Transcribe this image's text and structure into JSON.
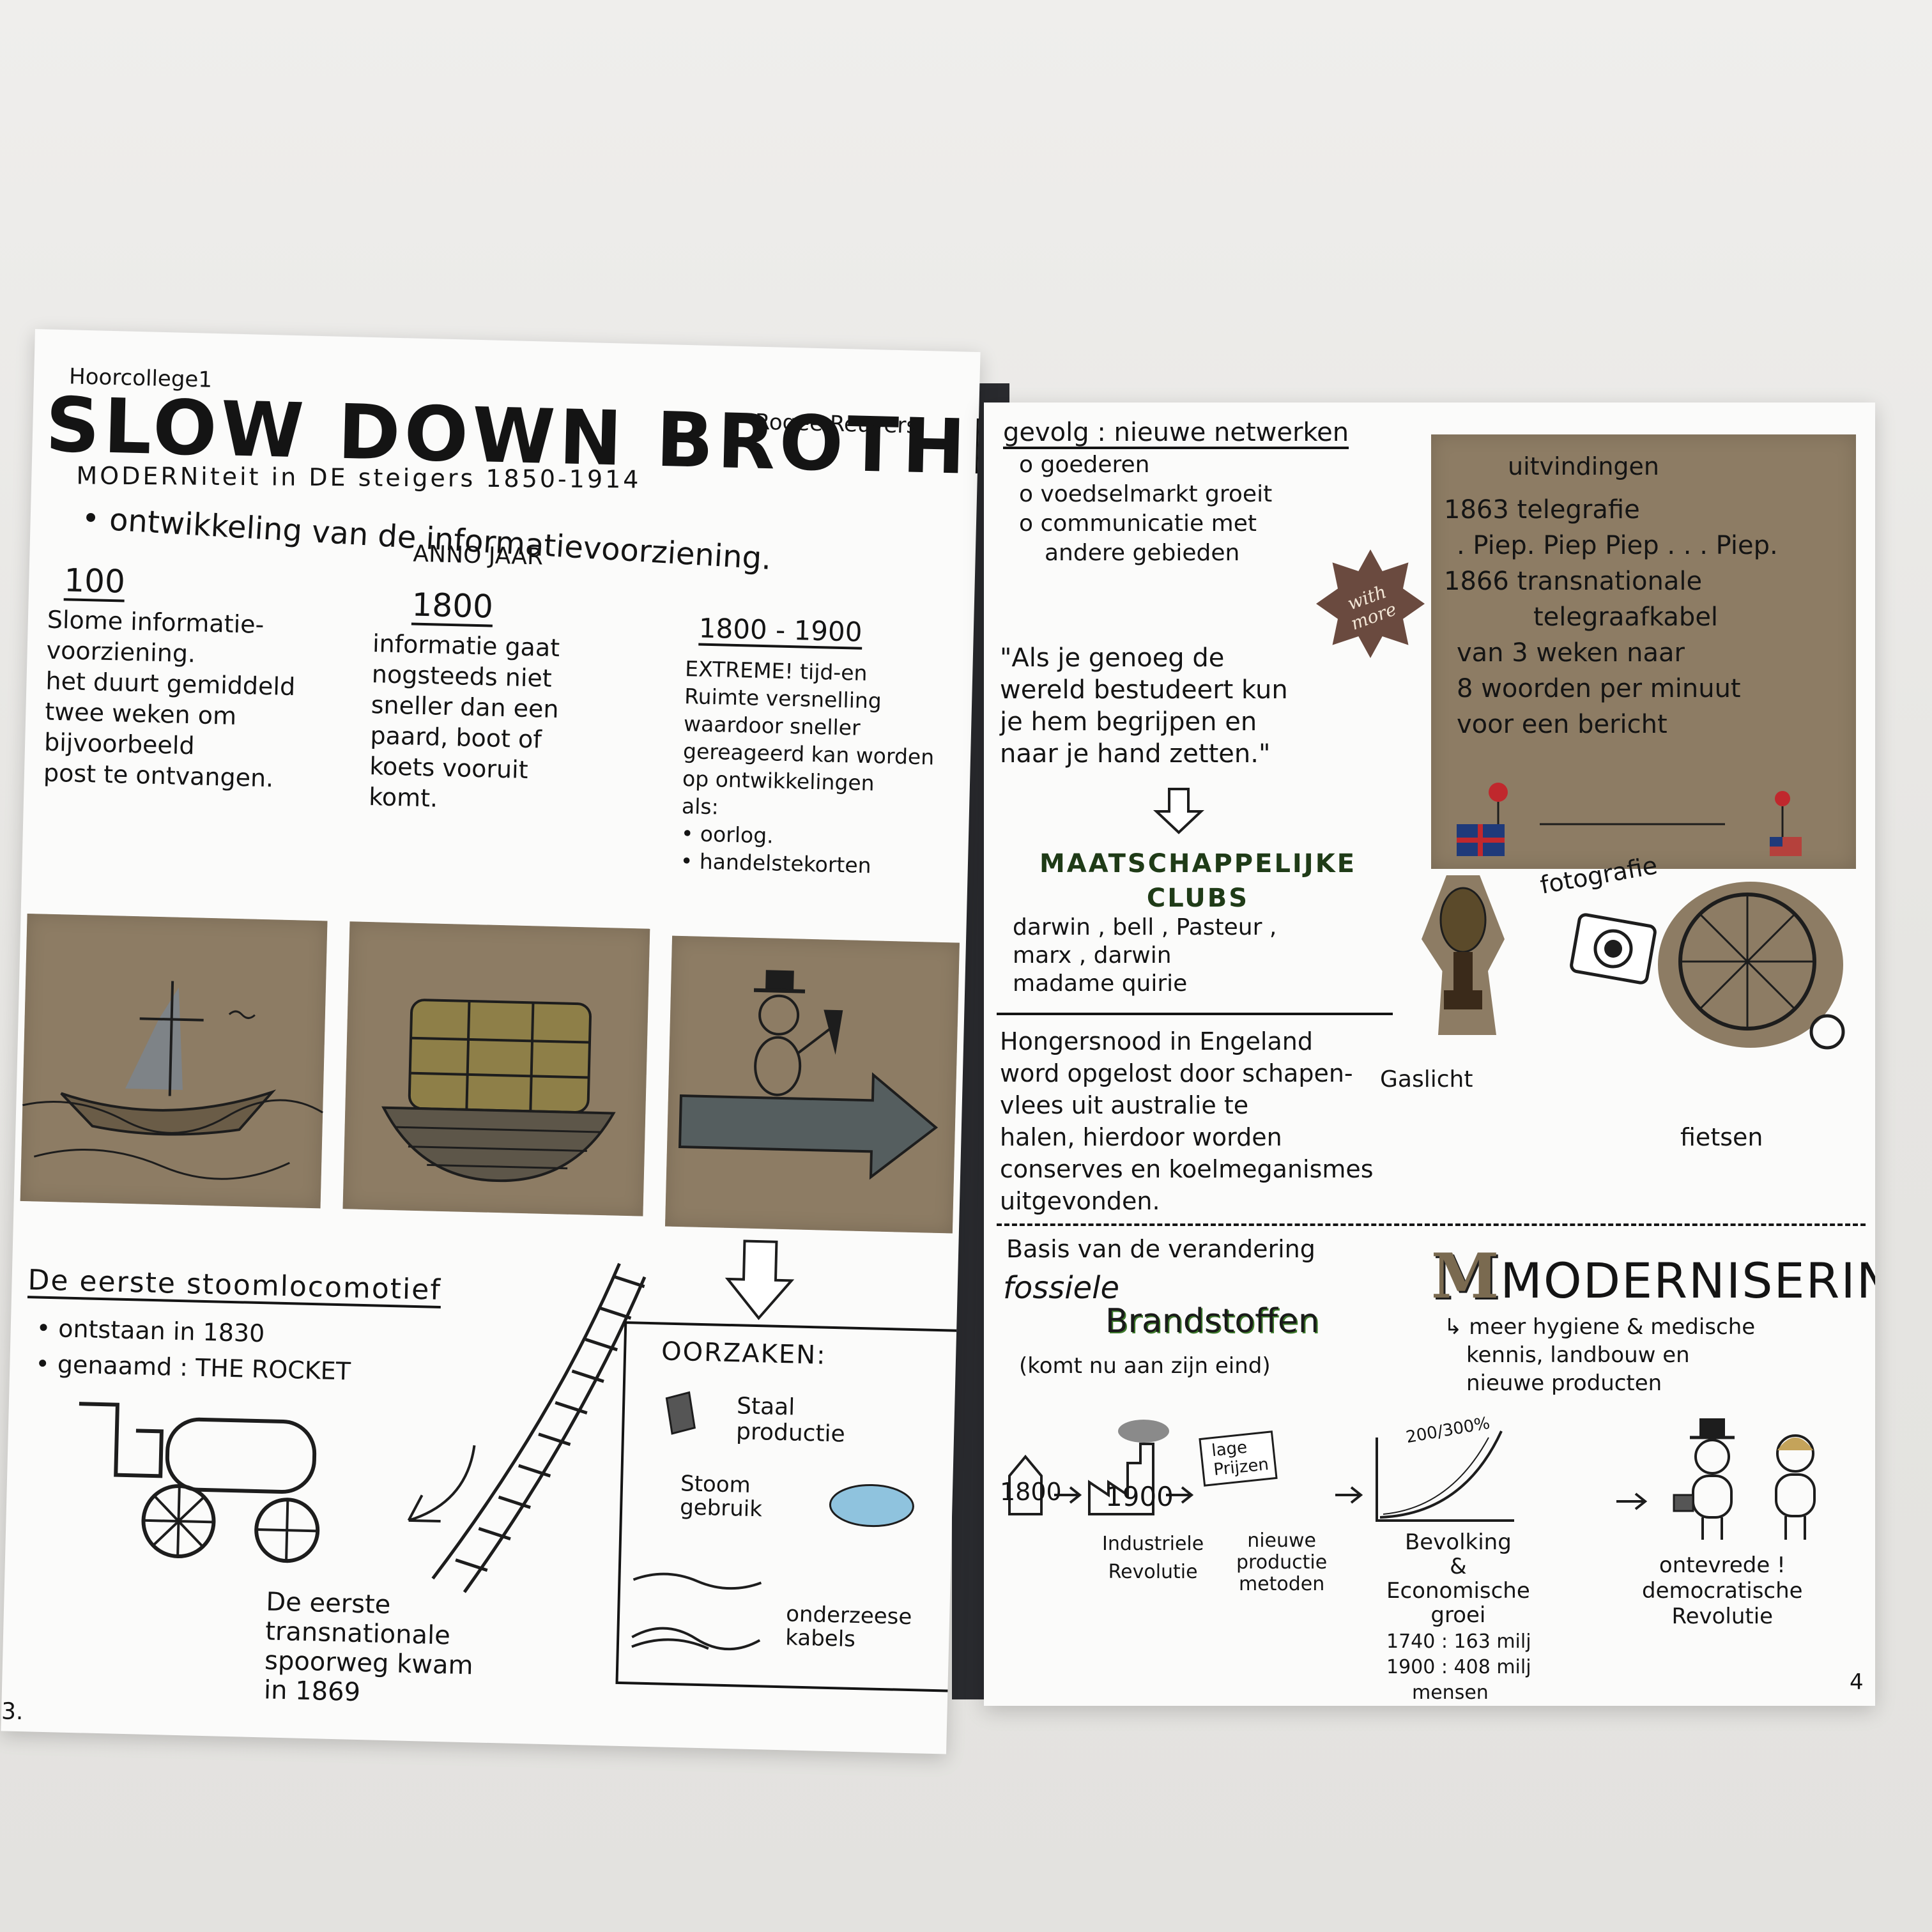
{
  "left_page": {
    "lecture": "Hoorcollege1",
    "title": "SLOW DOWN BROTHER",
    "author": "Rogee Reuvers",
    "subtitle": "MODERNiteit in DE steigers 1850-1914",
    "bullet": "• ontwikkeling van de informatievoorziening.",
    "anno": "ANNO JAAR",
    "columns": [
      {
        "year": "100",
        "lines": [
          "Slome informatie-",
          "voorziening.",
          "het duurt gemiddeld",
          "twee weken om",
          "bijvoorbeeld",
          "post te ontvangen."
        ]
      },
      {
        "year": "1800",
        "lines": [
          "informatie gaat",
          "nogsteeds niet",
          "sneller dan een",
          "paard, boot of",
          "koets vooruit",
          "komt."
        ]
      },
      {
        "year": "1800 - 1900",
        "lines": [
          "EXTREME! tijd-en",
          "Ruimte versnelling",
          "waardoor sneller",
          "gereageerd kan worden",
          "op ontwikkelingen",
          "als:",
          "• oorlog.",
          "• handelstekorten"
        ]
      }
    ],
    "locomotive": {
      "heading": "De eerste stoomlocomotief",
      "items": [
        "• ontstaan in 1830",
        "• genaamd : THE ROCKET"
      ],
      "caption": [
        "De eerste",
        "transnationale",
        "spoorweg kwam",
        "in 1869"
      ]
    },
    "causes": {
      "title": "OORZAKEN:",
      "items": [
        "Staal productie",
        "Stoom gebruik",
        "onderzeese kabels"
      ]
    },
    "page_number": "3."
  },
  "right_page": {
    "gevolg": {
      "title": "gevolg : nieuwe netwerken",
      "items": [
        "o goederen",
        "o voedselmarkt groeit",
        "o communicatie met",
        "andere gebieden"
      ]
    },
    "sticker": "with more",
    "quote": [
      "\"Als je genoeg de",
      "wereld bestudeert kun",
      "je hem begrijpen en",
      "naar je hand zetten.\""
    ],
    "clubs": {
      "title": "MAATSCHAPPELIJKE CLUBS",
      "names": [
        "darwin , bell , Pasteur ,",
        "marx , darwin",
        "madame quirie"
      ]
    },
    "inventions": {
      "title": "uitvindingen",
      "lines": [
        "1863 telegrafie",
        ". Piep. Piep Piep . . . Piep.",
        "1866 transnationale",
        "telegraafkabel",
        "van 3 weken naar",
        "8 woorden per minuut",
        "voor een bericht"
      ]
    },
    "labels": {
      "fotografie": "fotografie",
      "gaslicht": "Gaslicht",
      "fietsen": "fietsen"
    },
    "famine": [
      "Hongersnood in Engeland",
      "word opgelost door schapen-",
      "vlees uit australie te",
      "halen, hierdoor worden",
      "conserves en koelmeganismes",
      "uitgevonden."
    ],
    "basis": {
      "title": "Basis van de verandering",
      "fossil1": "fossiele",
      "fossil2": "Brandstoffen",
      "note": "(komt nu aan zijn eind)"
    },
    "modernisering": {
      "title": "MODERNISERING",
      "lines": [
        "↳ meer hygiene & medische",
        "kennis, landbouw en",
        "nieuwe producten"
      ]
    },
    "timeline": {
      "y1800": "1800",
      "y1900": "1900",
      "industrial": [
        "Industriele",
        "Revolutie"
      ],
      "lage": [
        "lage",
        "Prijzen"
      ],
      "production": [
        "nieuwe",
        "productie",
        "metoden"
      ],
      "growth": [
        "Bevolking",
        "&",
        "Economische",
        "groei"
      ],
      "pop": [
        "1740 : 163 milj",
        "1900 : 408 milj",
        "mensen"
      ],
      "percent": "200/300%",
      "unhappy": [
        "ontevrede !",
        "democratische",
        "Revolutie"
      ]
    },
    "page_number": "4"
  },
  "colors": {
    "paper": "#fbfbfa",
    "kraft": "#8d7c64",
    "ink": "#141414",
    "green": "#2d6a1e",
    "table": "#e9e8e5"
  }
}
